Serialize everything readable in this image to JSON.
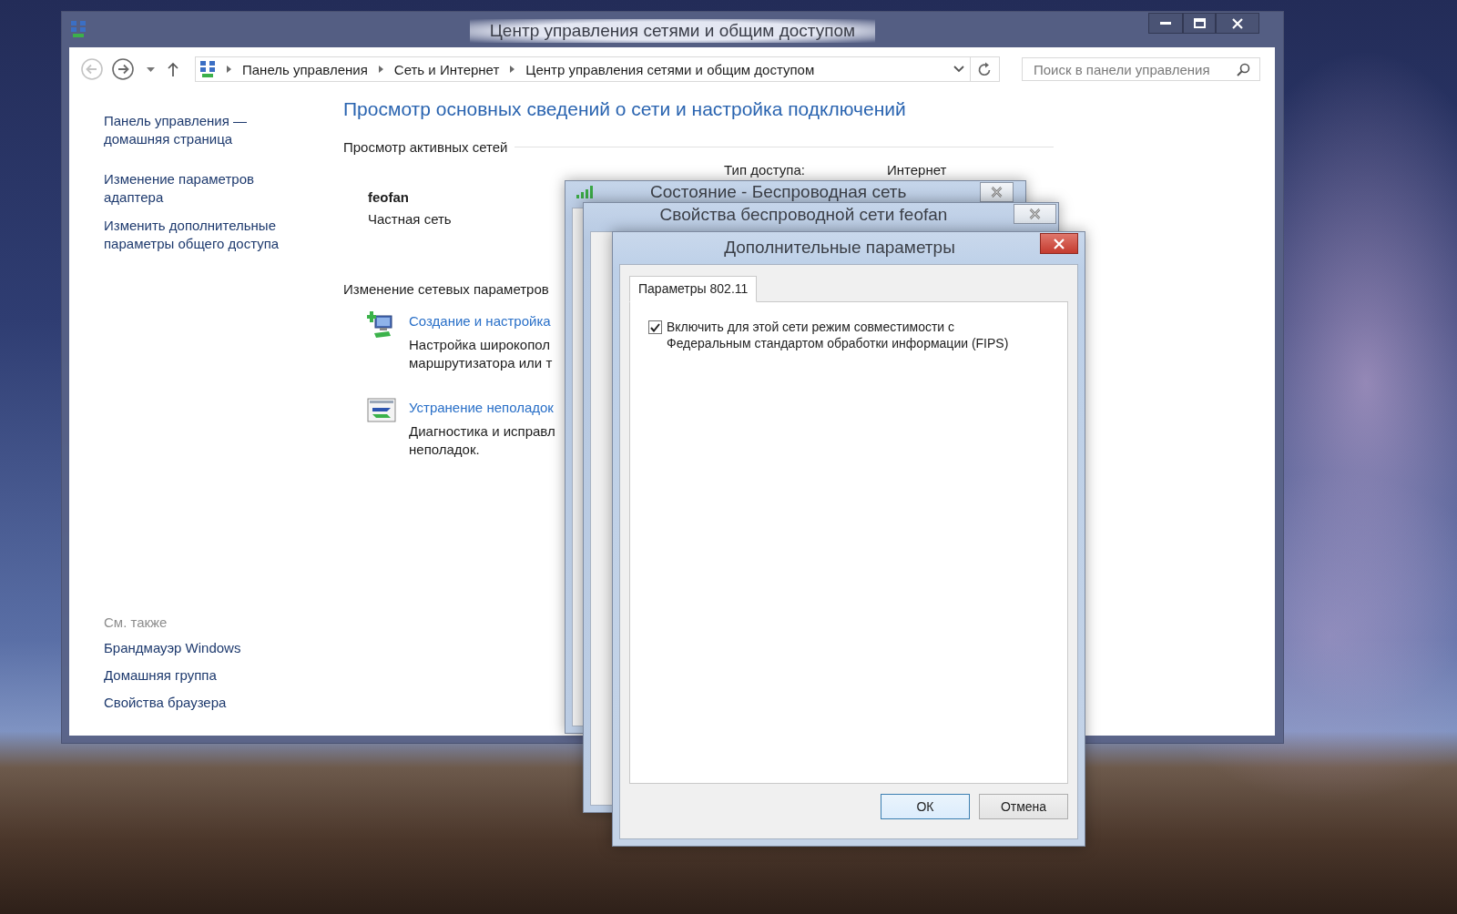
{
  "main_window": {
    "title": "Центр управления сетями и общим доступом",
    "breadcrumb": [
      "Панель управления",
      "Сеть и Интернет",
      "Центр управления сетями и общим доступом"
    ],
    "search": {
      "placeholder": "Поиск в панели управления"
    },
    "sidebar": {
      "links": [
        "Панель управления —\nдомашняя страница",
        "Изменение параметров\nадаптера",
        "Изменить дополнительные\nпараметры общего доступа"
      ],
      "see_also": {
        "title": "См. также",
        "links": [
          "Брандмауэр Windows",
          "Домашняя группа",
          "Свойства браузера"
        ]
      }
    },
    "heading": "Просмотр основных сведений о сети и настройка подключений",
    "active_networks": {
      "title": "Просмотр активных сетей",
      "network": {
        "name": "feofan",
        "type": "Частная сеть"
      },
      "access_label": "Тип доступа:",
      "access_value": "Интернет"
    },
    "change_settings": {
      "title": "Изменение сетевых параметров",
      "tasks": [
        {
          "kind": "setup",
          "link": "Создание и настройка",
          "description": "Настройка широкопол\nмаршрутизатора или т"
        },
        {
          "kind": "troubleshoot",
          "link": "Устранение неполадок",
          "description": "Диагностика и исправл\nнеполадок."
        }
      ]
    }
  },
  "status_dialog": {
    "title": "Состояние - Беспроводная сеть"
  },
  "properties_dialog": {
    "title": "Свойства беспроводной сети feofan"
  },
  "advanced_dialog": {
    "title": "Дополнительные параметры",
    "tabs": [
      {
        "label": "Параметры 802.11",
        "selected": true
      }
    ],
    "option": {
      "label": "Включить для этой сети режим совместимости с\nФедеральным стандартом обработки информации (FIPS)",
      "checked": true
    },
    "buttons": [
      {
        "label": "ОК",
        "default": true
      },
      {
        "label": "Отмена",
        "default": false
      }
    ]
  }
}
